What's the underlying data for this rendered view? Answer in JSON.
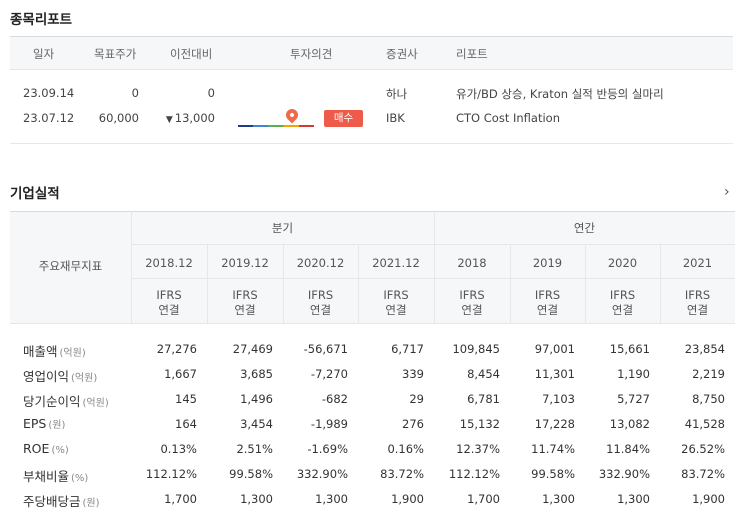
{
  "report": {
    "title": "종목리포트",
    "columns": {
      "date": "일자",
      "target": "목표주가",
      "change": "이전대비",
      "opinion": "투자의견",
      "firm": "증권사",
      "title": "리포트"
    },
    "rows": [
      {
        "date": "23.09.14",
        "target": "0",
        "change": "0",
        "change_dir": "",
        "opinion": "",
        "firm": "하나",
        "title": "유가/BD 상승, Kraton 실적 반등의 실마리"
      },
      {
        "date": "23.07.12",
        "target": "60,000",
        "change": "13,000",
        "change_dir": "▼",
        "opinion": "매수",
        "firm": "IBK",
        "title": "CTO Cost Inflation"
      }
    ]
  },
  "performance": {
    "title": "기업실적",
    "metric_header": "주요재무지표",
    "group_quarter": "분기",
    "group_annual": "연간",
    "periods": [
      "2018.12",
      "2019.12",
      "2020.12",
      "2021.12",
      "2018",
      "2019",
      "2020",
      "2021"
    ],
    "basis_line1": "IFRS",
    "basis_line2": "연결",
    "metrics": [
      {
        "name": "매출액",
        "unit": "(억원)",
        "values": [
          "27,276",
          "27,469",
          "-56,671",
          "6,717",
          "109,845",
          "97,001",
          "15,661",
          "23,854"
        ]
      },
      {
        "name": "영업이익",
        "unit": "(억원)",
        "values": [
          "1,667",
          "3,685",
          "-7,270",
          "339",
          "8,454",
          "11,301",
          "1,190",
          "2,219"
        ]
      },
      {
        "name": "당기순이익",
        "unit": "(억원)",
        "values": [
          "145",
          "1,496",
          "-682",
          "29",
          "6,781",
          "7,103",
          "5,727",
          "8,750"
        ]
      },
      {
        "name": "EPS",
        "unit": "(원)",
        "values": [
          "164",
          "3,454",
          "-1,989",
          "276",
          "15,132",
          "17,228",
          "13,082",
          "41,528"
        ]
      },
      {
        "name": "ROE",
        "unit": "(%)",
        "values": [
          "0.13%",
          "2.51%",
          "-1.69%",
          "0.16%",
          "12.37%",
          "11.74%",
          "11.84%",
          "26.52%"
        ]
      },
      {
        "name": "부채비율",
        "unit": "(%)",
        "values": [
          "112.12%",
          "99.58%",
          "332.90%",
          "83.72%",
          "112.12%",
          "99.58%",
          "332.90%",
          "83.72%"
        ]
      },
      {
        "name": "주당배당금",
        "unit": "(원)",
        "values": [
          "1,700",
          "1,300",
          "1,300",
          "1,900",
          "1,700",
          "1,300",
          "1,300",
          "1,900"
        ]
      }
    ]
  }
}
